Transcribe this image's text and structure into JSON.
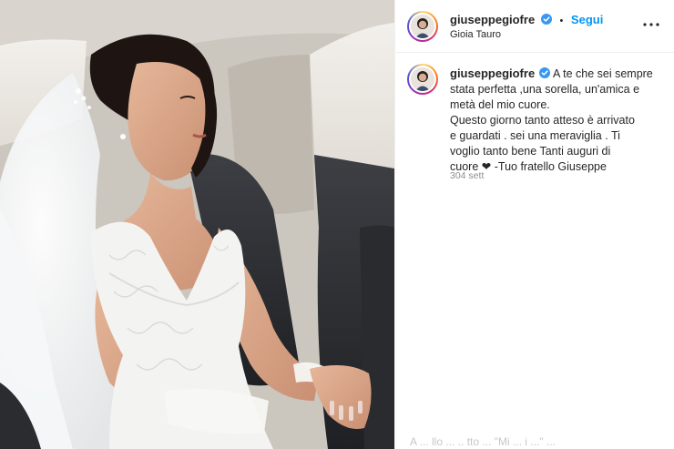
{
  "post": {
    "username": "giuseppegiofre",
    "verified": true,
    "follow_label": "Segui",
    "separator": "•",
    "location": "Gioia Tauro",
    "more_icon": "more-horizontal-icon"
  },
  "caption": {
    "username": "giuseppegiofre",
    "lines": [
      "A te che sei sempre",
      "stata perfetta ,una sorella, un'amica e",
      "metà del mio cuore.",
      "Questo giorno tanto atteso è arrivato",
      "e guardati . sei una meraviglia . Ti",
      "voglio tanto bene Tanti auguri di",
      "cuore",
      "-Tuo fratello Giuseppe"
    ],
    "heart": "❤",
    "timestamp": "304 sett"
  },
  "footer": {
    "partial_text": "A ... llo ... .. tto ... \"Mi ... i ...\" ..."
  },
  "colors": {
    "link": "#0095f6",
    "verified": "#3897f0",
    "text": "#262626",
    "muted": "#8e8e8e"
  },
  "photo": {
    "icon": "bride-in-car-photo"
  }
}
